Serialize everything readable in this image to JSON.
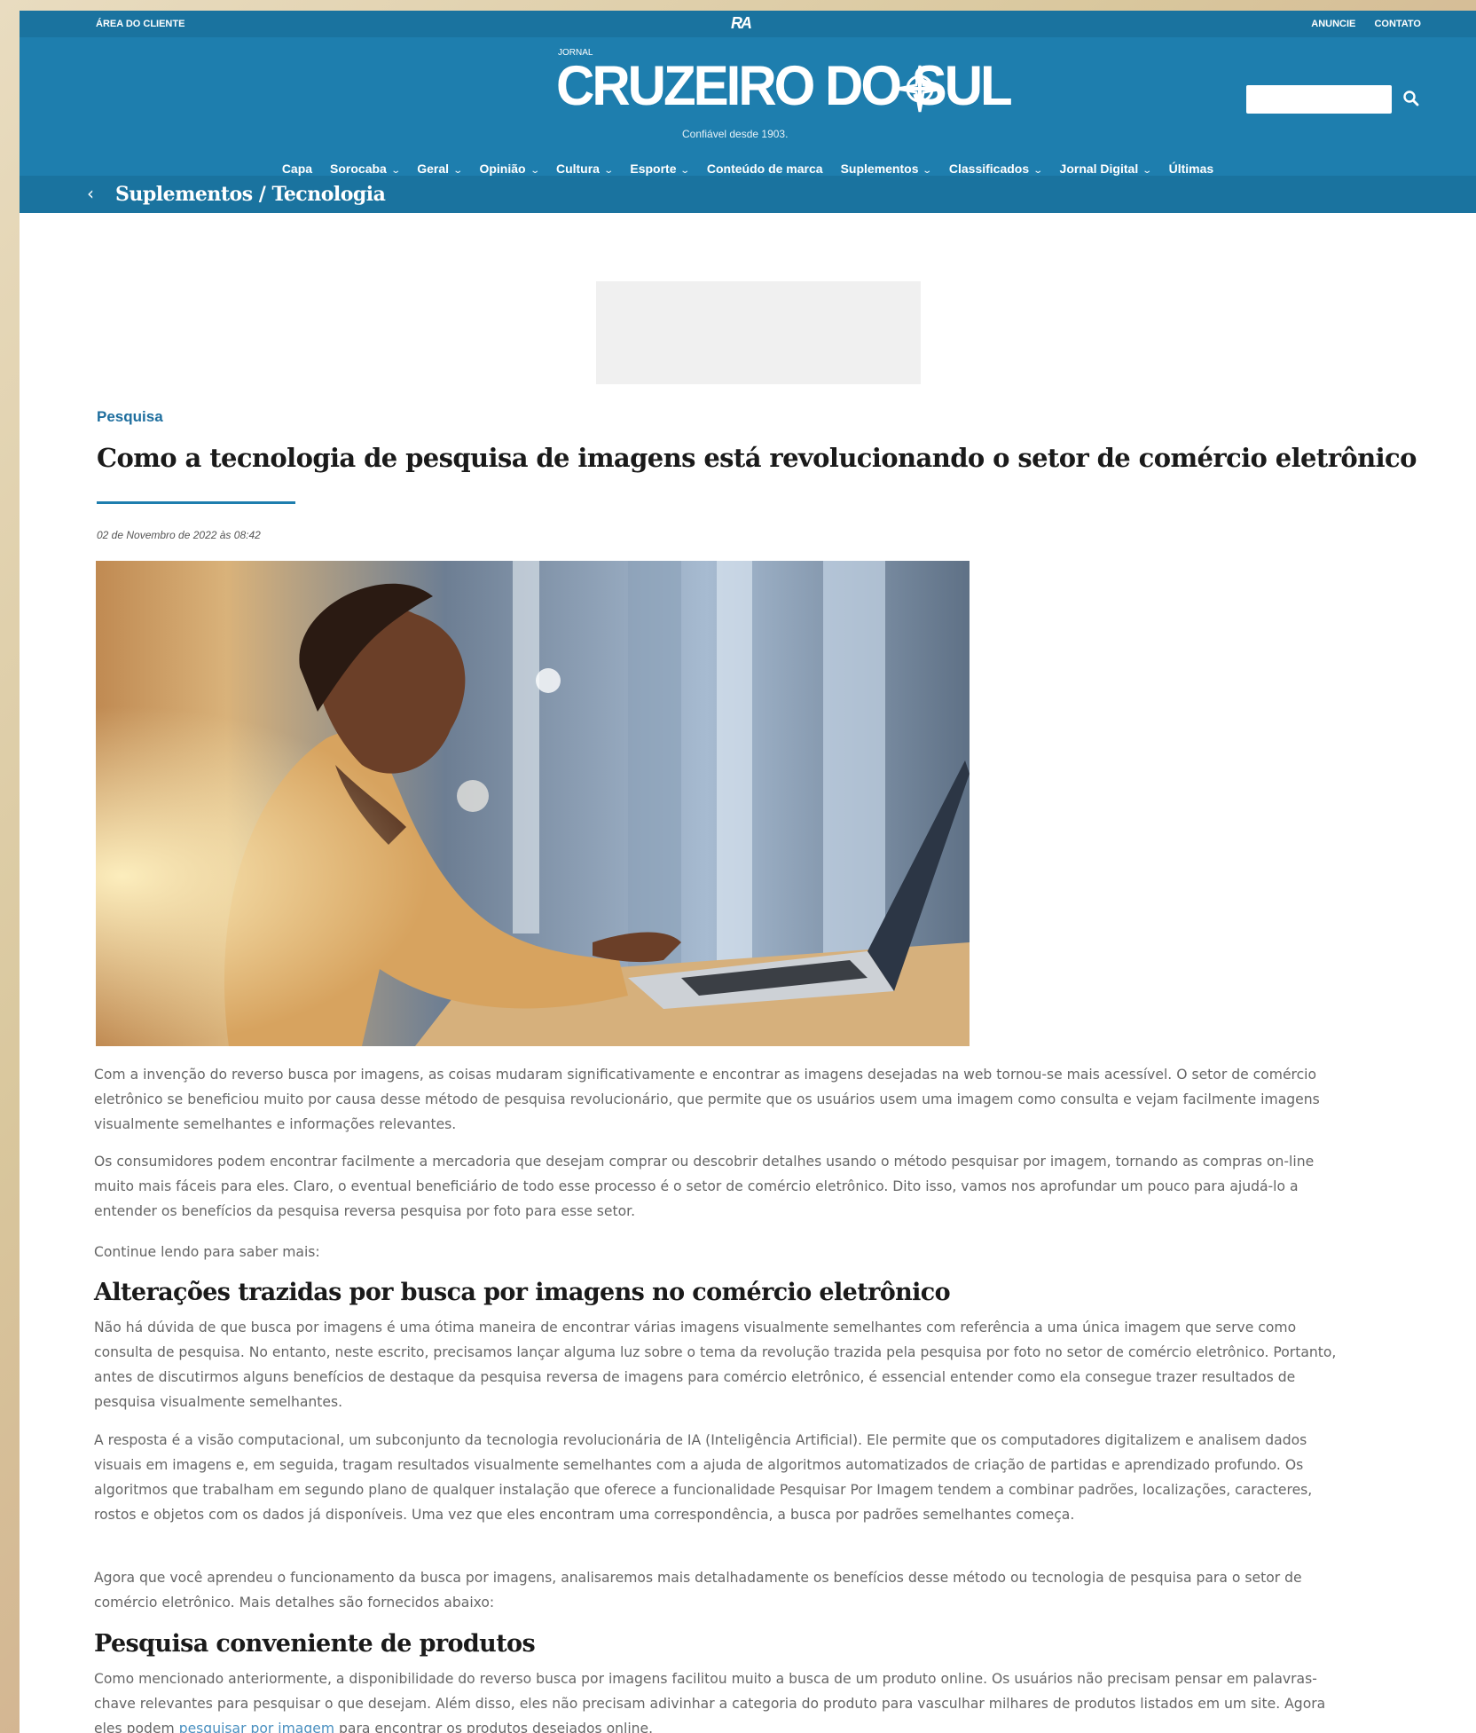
{
  "topbar": {
    "client_area": "ÁREA DO CLIENTE",
    "brand_mark": "RA",
    "advertise": "ANUNCIE",
    "contact": "CONTATO"
  },
  "header": {
    "logo_prefix": "JORNAL",
    "logo_text": "CRUZEIRO DO SUL",
    "tagline": "Confiável desde 1903.",
    "search_placeholder": "",
    "colors": {
      "header_blue": "#1e7eae",
      "bar_blue": "#1a739f"
    }
  },
  "nav": {
    "items": [
      {
        "label": "Capa",
        "dropdown": false
      },
      {
        "label": "Sorocaba",
        "dropdown": true
      },
      {
        "label": "Geral",
        "dropdown": true
      },
      {
        "label": "Opinião",
        "dropdown": true
      },
      {
        "label": "Cultura",
        "dropdown": true
      },
      {
        "label": "Esporte",
        "dropdown": true
      },
      {
        "label": "Conteúdo de marca",
        "dropdown": false
      },
      {
        "label": "Suplementos",
        "dropdown": true
      },
      {
        "label": "Classificados",
        "dropdown": true
      },
      {
        "label": "Jornal Digital",
        "dropdown": true
      },
      {
        "label": "Últimas",
        "dropdown": false
      }
    ]
  },
  "breadcrumb": {
    "back_icon": "chevron-left-icon",
    "text": "Suplementos / Tecnologia"
  },
  "article": {
    "category": "Pesquisa",
    "title": "Como a tecnologia de pesquisa de imagens está revolucionando o setor de comércio eletrônico",
    "date": "02 de Novembro de 2022 às 08:42",
    "p1": "Com a invenção do reverso busca por imagens, as coisas mudaram significativamente e encontrar as imagens desejadas na web tornou-se mais acessível. O setor de comércio eletrônico se beneficiou muito por causa desse método de pesquisa revolucionário, que permite que os usuários usem uma imagem como consulta e vejam facilmente imagens visualmente semelhantes e informações relevantes.",
    "p2": "Os consumidores podem encontrar facilmente a mercadoria que desejam comprar ou descobrir detalhes usando o método pesquisar por imagem, tornando as compras on-line muito mais fáceis para eles. Claro, o eventual beneficiário de todo esse processo é o setor de comércio eletrônico. Dito isso, vamos nos aprofundar um pouco para ajudá-lo a entender os benefícios da pesquisa reversa pesquisa por foto para esse setor.",
    "p3": "Continue lendo para saber mais:",
    "h2_1": "Alterações trazidas por busca por imagens no comércio eletrônico",
    "p4": "Não há dúvida de que busca por imagens é uma ótima maneira de encontrar várias imagens visualmente semelhantes com referência a uma única imagem que serve como consulta de pesquisa. No entanto, neste escrito, precisamos lançar alguma luz sobre o tema da revolução trazida pela pesquisa por foto no setor de comércio eletrônico. Portanto, antes de discutirmos alguns benefícios de destaque da pesquisa reversa de imagens para comércio eletrônico, é essencial entender como ela consegue trazer resultados de pesquisa visualmente semelhantes.",
    "p5": "A resposta é a visão computacional, um subconjunto da tecnologia revolucionária de IA (Inteligência Artificial). Ele permite que os computadores digitalizem e analisem dados visuais em imagens e, em seguida, tragam resultados visualmente semelhantes com a ajuda de algoritmos automatizados de criação de partidas e aprendizado profundo. Os algoritmos que trabalham em segundo plano de qualquer instalação que oferece a funcionalidade Pesquisar Por Imagem tendem a combinar padrões, localizações, caracteres, rostos e objetos com os dados já disponíveis. Uma vez que eles encontram uma correspondência, a busca por padrões semelhantes começa.",
    "p6": "Agora que você aprendeu o funcionamento da busca por imagens, analisaremos mais detalhadamente os benefícios desse método ou tecnologia de pesquisa para o setor de comércio eletrônico. Mais detalhes são fornecidos abaixo:",
    "h2_2": "Pesquisa conveniente de produtos",
    "p7_before": "Como mencionado anteriormente, a disponibilidade do reverso busca por imagens facilitou muito a busca de um produto online. Os usuários não precisam pensar em palavras-chave relevantes para pesquisar o que desejam. Além disso, eles não precisam adivinhar a categoria do produto para vasculhar milhares de produtos listados em um site. Agora eles podem ",
    "p7_link": "pesquisar por imagem",
    "p7_after": " para encontrar os produtos desejados online."
  }
}
